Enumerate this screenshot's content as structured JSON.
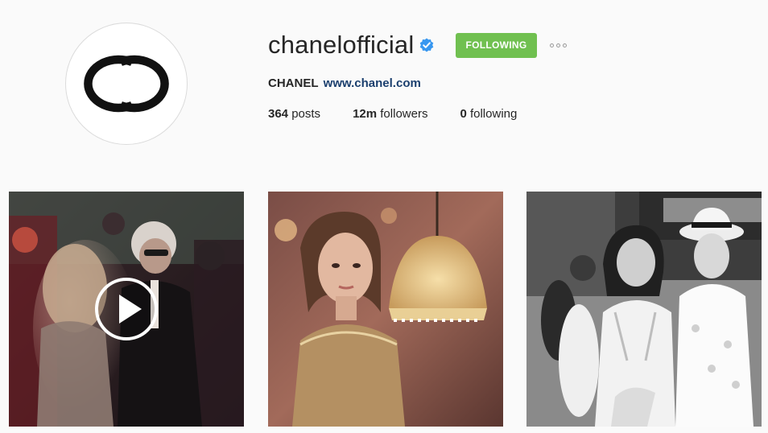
{
  "profile": {
    "username": "chanelofficial",
    "verified": true,
    "follow_button_label": "FOLLOWING",
    "full_name": "CHANEL",
    "website": "www.chanel.com",
    "avatar_icon": "chanel-logo-icon"
  },
  "stats": {
    "posts_count": "364",
    "posts_label": "posts",
    "followers_count": "12m",
    "followers_label": "followers",
    "following_count": "0",
    "following_label": "following"
  },
  "posts": [
    {
      "type": "video",
      "icon": "play-icon"
    },
    {
      "type": "photo"
    },
    {
      "type": "photo"
    }
  ],
  "colors": {
    "following_button": "#70c050",
    "verified_badge": "#3897f0",
    "website_link": "#1b3f6e",
    "background": "#fafafa"
  }
}
